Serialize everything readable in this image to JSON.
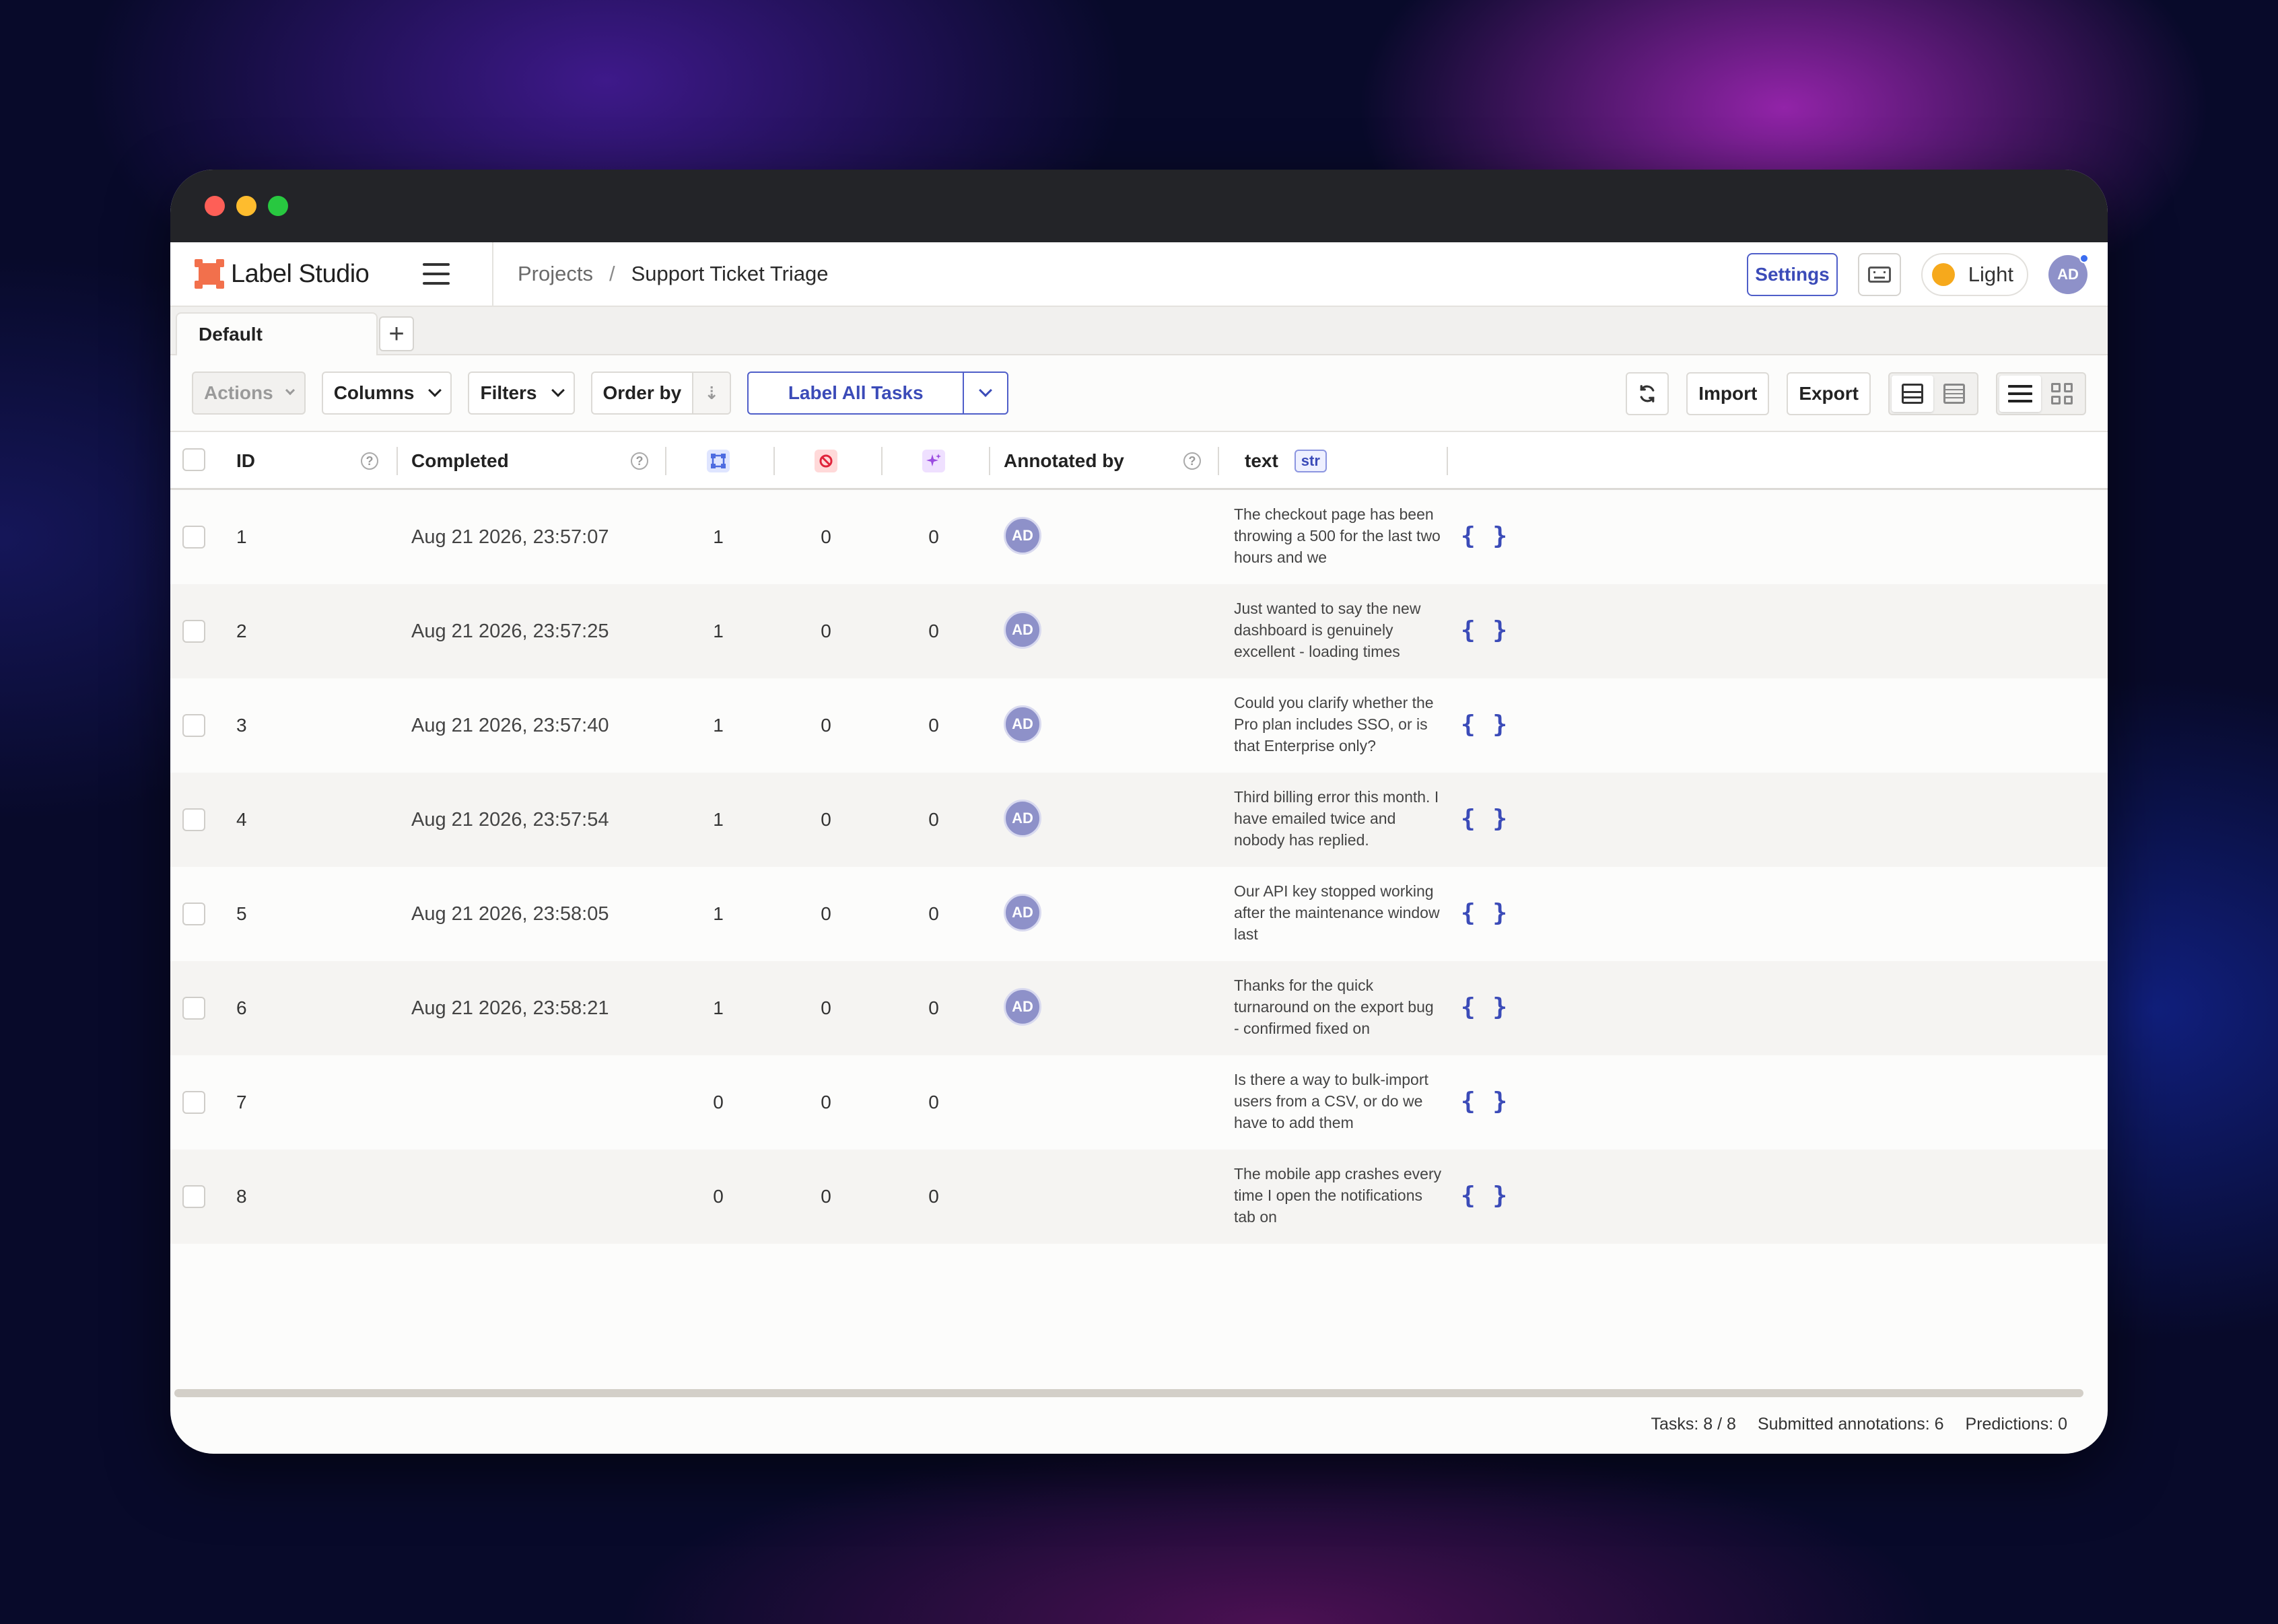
{
  "app": {
    "brand": "Label Studio"
  },
  "breadcrumb": {
    "projects": "Projects",
    "separator": "/",
    "current": "Support Ticket Triage"
  },
  "header": {
    "settings_label": "Settings",
    "theme_label": "Light",
    "user_initials": "AD"
  },
  "tabs": [
    {
      "label": "Default"
    }
  ],
  "tab_add_label": "+",
  "toolbar": {
    "actions_label": "Actions",
    "columns_label": "Columns",
    "filters_label": "Filters",
    "order_by_label": "Order by",
    "label_all_label": "Label All Tasks",
    "import_label": "Import",
    "export_label": "Export"
  },
  "columns": {
    "id": "ID",
    "completed": "Completed",
    "annotated_by": "Annotated by",
    "text": "text",
    "text_type": "str"
  },
  "icons": {
    "annotations": "annotations-icon",
    "cancelled": "cancelled-icon",
    "predictions": "predictions-icon",
    "json": "{ }"
  },
  "rows": [
    {
      "id": "1",
      "completed": "Aug 21 2026, 23:57:07",
      "annotations": "1",
      "cancelled": "0",
      "predictions": "0",
      "annotator": "AD",
      "text": "The checkout page has been throwing a 500 for the last two hours and we"
    },
    {
      "id": "2",
      "completed": "Aug 21 2026, 23:57:25",
      "annotations": "1",
      "cancelled": "0",
      "predictions": "0",
      "annotator": "AD",
      "text": "Just wanted to say the new dashboard is genuinely excellent - loading times"
    },
    {
      "id": "3",
      "completed": "Aug 21 2026, 23:57:40",
      "annotations": "1",
      "cancelled": "0",
      "predictions": "0",
      "annotator": "AD",
      "text": "Could you clarify whether the Pro plan includes SSO, or is that Enterprise only?"
    },
    {
      "id": "4",
      "completed": "Aug 21 2026, 23:57:54",
      "annotations": "1",
      "cancelled": "0",
      "predictions": "0",
      "annotator": "AD",
      "text": "Third billing error this month. I have emailed twice and nobody has replied."
    },
    {
      "id": "5",
      "completed": "Aug 21 2026, 23:58:05",
      "annotations": "1",
      "cancelled": "0",
      "predictions": "0",
      "annotator": "AD",
      "text": "Our API key stopped working after the maintenance window last"
    },
    {
      "id": "6",
      "completed": "Aug 21 2026, 23:58:21",
      "annotations": "1",
      "cancelled": "0",
      "predictions": "0",
      "annotator": "AD",
      "text": "Thanks for the quick turnaround on the export bug - confirmed fixed on"
    },
    {
      "id": "7",
      "completed": "",
      "annotations": "0",
      "cancelled": "0",
      "predictions": "0",
      "annotator": "",
      "text": "Is there a way to bulk-import users from a CSV, or do we have to add them"
    },
    {
      "id": "8",
      "completed": "",
      "annotations": "0",
      "cancelled": "0",
      "predictions": "0",
      "annotator": "",
      "text": "The mobile app crashes every time I open the notifications tab on"
    }
  ],
  "footer": {
    "tasks": "Tasks: 8 / 8",
    "submitted": "Submitted annotations: 6",
    "predictions": "Predictions: 0"
  },
  "colors": {
    "accent": "#4f5ec9",
    "logo": "#f2704c",
    "avatar": "#8e91c9",
    "theme_dot": "#f6a91c"
  }
}
